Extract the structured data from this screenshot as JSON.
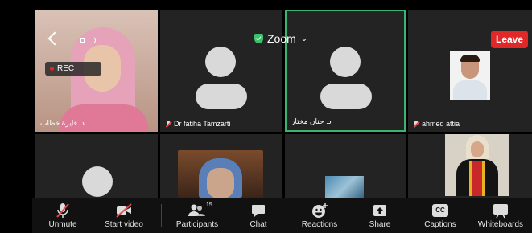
{
  "meeting": {
    "title": "Zoom",
    "leave_label": "Leave",
    "rec_label": "REC"
  },
  "participants": [
    {
      "name": "د. فايزة خطاب",
      "muted": true
    },
    {
      "name": "Dr fatiha Tamzarti",
      "muted": true
    },
    {
      "name": "د. حنان مختار",
      "muted": false
    },
    {
      "name": "ahmed attia",
      "muted": true
    }
  ],
  "toolbar": {
    "unmute": "Unmute",
    "start_video": "Start video",
    "participants": "Participants",
    "participants_count": "15",
    "chat": "Chat",
    "reactions": "Reactions",
    "share": "Share",
    "captions": "Captions",
    "captions_icon_text": "CC",
    "whiteboards": "Whiteboards"
  },
  "colors": {
    "leave": "#e02828",
    "active_speaker_border": "#3cb371",
    "zoom_shield": "#3cc06b",
    "tile_bg": "#232323"
  }
}
